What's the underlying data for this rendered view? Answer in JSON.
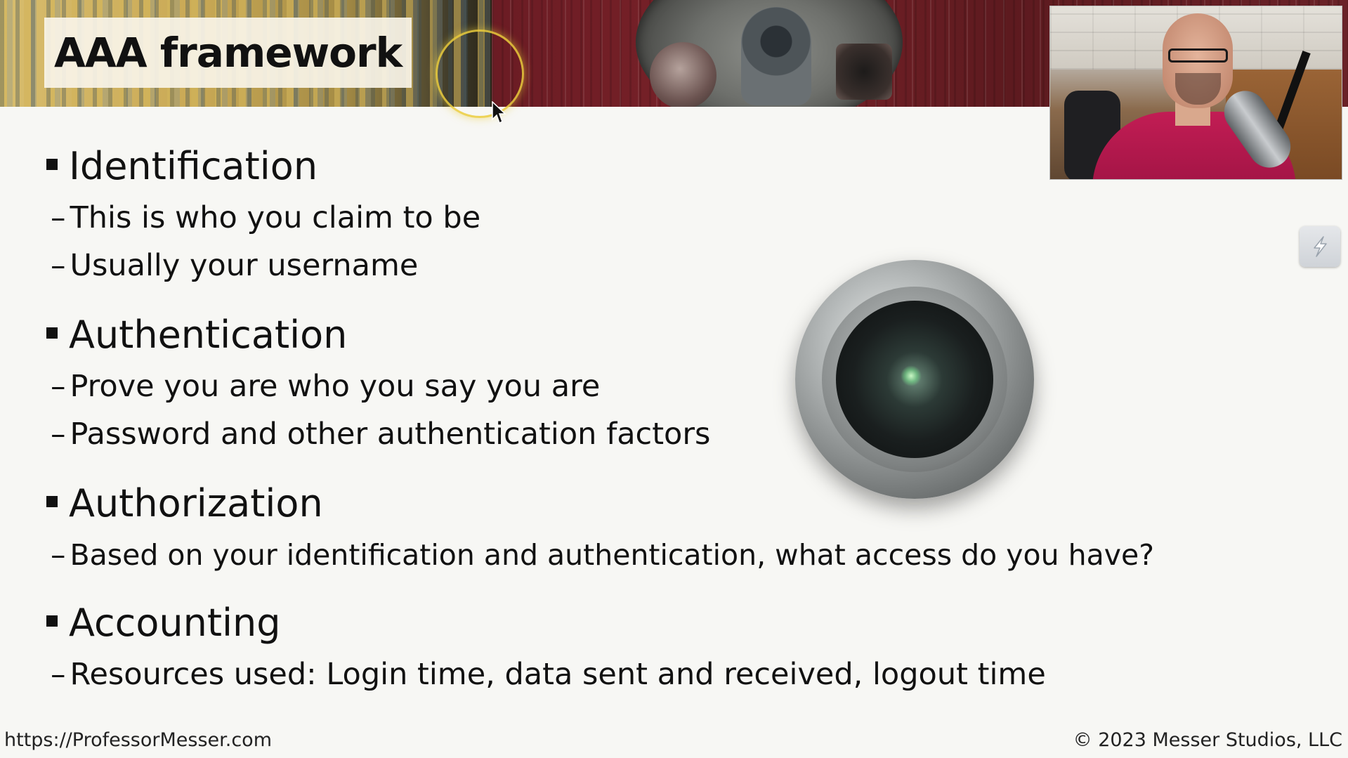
{
  "slide": {
    "title": "AAA framework",
    "sections": [
      {
        "heading": "Identification",
        "items": [
          "This is who you claim to be",
          "Usually your username"
        ]
      },
      {
        "heading": "Authentication",
        "items": [
          "Prove you are who you say you are",
          "Password and other authentication factors"
        ]
      },
      {
        "heading": "Authorization",
        "items": [
          "Based on your identification and authentication, what access do you have?"
        ]
      },
      {
        "heading": "Accounting",
        "items": [
          "Resources used: Login time, data sent and received, logout time"
        ]
      }
    ],
    "dash": "–"
  },
  "footer": {
    "website": "https://ProfessorMesser.com",
    "copyright": "© 2023 Messer Studios, LLC"
  },
  "icons": {
    "side_widget": "lightning-icon",
    "cursor": "mouse-pointer-icon",
    "bullet": "square-bullet-icon"
  },
  "colors": {
    "text": "#111111",
    "background": "#f7f7f4",
    "cursor_highlight": "#ebcd3c"
  }
}
